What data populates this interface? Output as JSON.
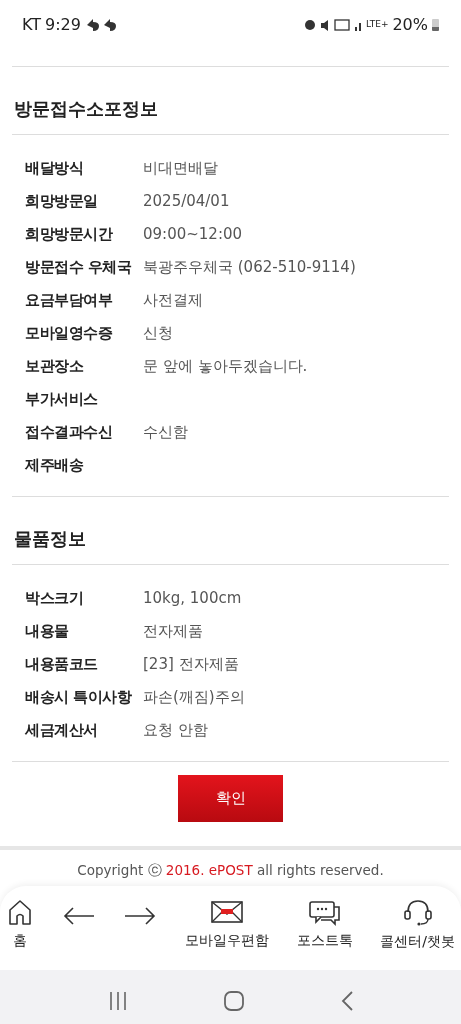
{
  "status_bar": {
    "carrier": "KT",
    "time": "9:29",
    "network": "LTE+",
    "battery": "20%"
  },
  "sections": [
    {
      "title": "방문접수소포정보",
      "rows": [
        {
          "label": "배달방식",
          "value": "비대면배달"
        },
        {
          "label": "희망방문일",
          "value": "2025/04/01"
        },
        {
          "label": "희망방문시간",
          "value": "09:00~12:00"
        },
        {
          "label": "방문접수 우체국",
          "value": "북광주우체국 (062-510-9114)"
        },
        {
          "label": "요금부담여부",
          "value": "사전결제"
        },
        {
          "label": "모바일영수증",
          "value": "신청"
        },
        {
          "label": "보관장소",
          "value": "문 앞에 놓아두겠습니다."
        },
        {
          "label": "부가서비스"
        },
        {
          "label": "접수결과수신",
          "value": "수신함"
        },
        {
          "label": "제주배송"
        }
      ]
    },
    {
      "title": "물품정보",
      "rows": [
        {
          "label": "박스크기",
          "value": "10kg, 100cm"
        },
        {
          "label": "내용물",
          "value": "전자제품"
        },
        {
          "label": "내용품코드",
          "value": "[23] 전자제품"
        },
        {
          "label": "배송시 특이사항",
          "value": "파손(깨짐)주의"
        },
        {
          "label": "세금계산서",
          "value": "요청 안함"
        }
      ]
    }
  ],
  "confirm_button": "확인",
  "copyright": {
    "prefix": "Copyright ⓒ",
    "highlight": "2016. ePOST",
    "suffix": "all rights reserved."
  },
  "bottom_nav": [
    {
      "kind": "home",
      "label": "홈"
    },
    {
      "kind": "back"
    },
    {
      "kind": "forward"
    },
    {
      "kind": "mail",
      "label": "모바일우편함"
    },
    {
      "kind": "chat",
      "label": "포스트톡"
    },
    {
      "kind": "headset",
      "label": "콜센터/챗봇"
    }
  ]
}
